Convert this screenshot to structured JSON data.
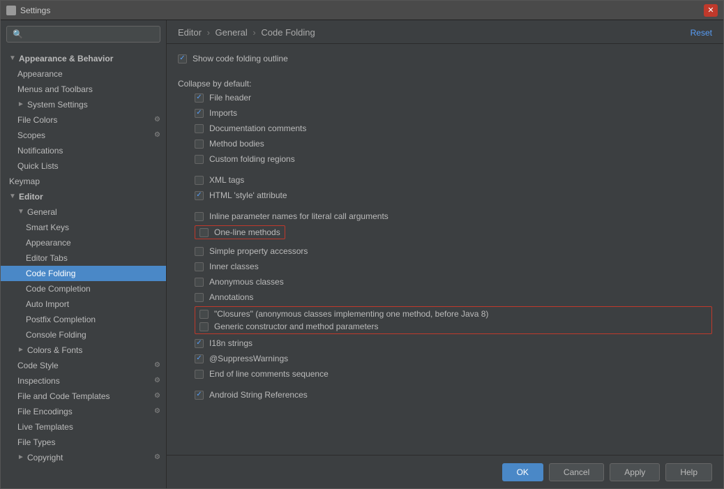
{
  "window": {
    "title": "Settings",
    "close_label": "✕"
  },
  "sidebar": {
    "search_placeholder": "",
    "items": [
      {
        "id": "appearance-behavior",
        "label": "Appearance & Behavior",
        "indent": 0,
        "arrow": "▼",
        "type": "group"
      },
      {
        "id": "appearance",
        "label": "Appearance",
        "indent": 1,
        "type": "leaf"
      },
      {
        "id": "menus-toolbars",
        "label": "Menus and Toolbars",
        "indent": 1,
        "type": "leaf"
      },
      {
        "id": "system-settings",
        "label": "System Settings",
        "indent": 1,
        "arrow": "►",
        "type": "group"
      },
      {
        "id": "file-colors",
        "label": "File Colors",
        "indent": 1,
        "type": "leaf",
        "gear": true
      },
      {
        "id": "scopes",
        "label": "Scopes",
        "indent": 1,
        "type": "leaf",
        "gear": true
      },
      {
        "id": "notifications",
        "label": "Notifications",
        "indent": 1,
        "type": "leaf"
      },
      {
        "id": "quick-lists",
        "label": "Quick Lists",
        "indent": 1,
        "type": "leaf"
      },
      {
        "id": "keymap",
        "label": "Keymap",
        "indent": 0,
        "type": "leaf"
      },
      {
        "id": "editor",
        "label": "Editor",
        "indent": 0,
        "arrow": "▼",
        "type": "group"
      },
      {
        "id": "general",
        "label": "General",
        "indent": 1,
        "arrow": "▼",
        "type": "group"
      },
      {
        "id": "smart-keys",
        "label": "Smart Keys",
        "indent": 2,
        "type": "leaf"
      },
      {
        "id": "appearance2",
        "label": "Appearance",
        "indent": 2,
        "type": "leaf"
      },
      {
        "id": "editor-tabs",
        "label": "Editor Tabs",
        "indent": 2,
        "type": "leaf"
      },
      {
        "id": "code-folding",
        "label": "Code Folding",
        "indent": 2,
        "type": "leaf",
        "selected": true
      },
      {
        "id": "code-completion",
        "label": "Code Completion",
        "indent": 2,
        "type": "leaf"
      },
      {
        "id": "auto-import",
        "label": "Auto Import",
        "indent": 2,
        "type": "leaf"
      },
      {
        "id": "postfix-completion",
        "label": "Postfix Completion",
        "indent": 2,
        "type": "leaf"
      },
      {
        "id": "console-folding",
        "label": "Console Folding",
        "indent": 2,
        "type": "leaf"
      },
      {
        "id": "colors-fonts",
        "label": "Colors & Fonts",
        "indent": 1,
        "arrow": "►",
        "type": "group"
      },
      {
        "id": "code-style",
        "label": "Code Style",
        "indent": 1,
        "type": "leaf",
        "gear": true
      },
      {
        "id": "inspections",
        "label": "Inspections",
        "indent": 1,
        "type": "leaf",
        "gear": true
      },
      {
        "id": "file-code-templates",
        "label": "File and Code Templates",
        "indent": 1,
        "type": "leaf",
        "gear": true
      },
      {
        "id": "file-encodings",
        "label": "File Encodings",
        "indent": 1,
        "type": "leaf",
        "gear": true
      },
      {
        "id": "live-templates",
        "label": "Live Templates",
        "indent": 1,
        "type": "leaf"
      },
      {
        "id": "file-types",
        "label": "File Types",
        "indent": 1,
        "type": "leaf"
      },
      {
        "id": "copyright",
        "label": "Copyright",
        "indent": 1,
        "arrow": "►",
        "type": "group"
      }
    ]
  },
  "breadcrumb": {
    "parts": [
      "Editor",
      "General",
      "Code Folding"
    ]
  },
  "reset_label": "Reset",
  "panel": {
    "show_outline_label": "Show code folding outline",
    "show_outline_checked": true,
    "collapse_by_default_label": "Collapse by default:",
    "items": [
      {
        "id": "file-header",
        "label": "File header",
        "checked": true
      },
      {
        "id": "imports",
        "label": "Imports",
        "checked": true
      },
      {
        "id": "doc-comments",
        "label": "Documentation comments",
        "checked": false
      },
      {
        "id": "method-bodies",
        "label": "Method bodies",
        "checked": false
      },
      {
        "id": "custom-folding",
        "label": "Custom folding regions",
        "checked": false
      }
    ],
    "items2": [
      {
        "id": "xml-tags",
        "label": "XML tags",
        "checked": false
      },
      {
        "id": "html-style",
        "label": "HTML 'style' attribute",
        "checked": true
      }
    ],
    "items3": [
      {
        "id": "inline-params",
        "label": "Inline parameter names for literal call arguments",
        "checked": false
      },
      {
        "id": "one-line-methods",
        "label": "One-line methods",
        "checked": false,
        "highlighted": true
      },
      {
        "id": "simple-property",
        "label": "Simple property accessors",
        "checked": false
      },
      {
        "id": "inner-classes",
        "label": "Inner classes",
        "checked": false
      },
      {
        "id": "anonymous-classes",
        "label": "Anonymous classes",
        "checked": false
      },
      {
        "id": "annotations",
        "label": "Annotations",
        "checked": false
      },
      {
        "id": "closures",
        "label": "\"Closures\" (anonymous classes implementing one method, before Java 8)",
        "checked": false,
        "highlighted": true
      },
      {
        "id": "generic-constructor",
        "label": "Generic constructor and method parameters",
        "checked": false,
        "highlighted": true
      },
      {
        "id": "i18n",
        "label": "I18n strings",
        "checked": true
      },
      {
        "id": "suppress-warnings",
        "label": "@SuppressWarnings",
        "checked": true
      },
      {
        "id": "eol-comments",
        "label": "End of line comments sequence",
        "checked": false
      },
      {
        "id": "android-string",
        "label": "Android String References",
        "checked": true
      }
    ]
  },
  "footer": {
    "ok_label": "OK",
    "cancel_label": "Cancel",
    "apply_label": "Apply",
    "help_label": "Help"
  }
}
